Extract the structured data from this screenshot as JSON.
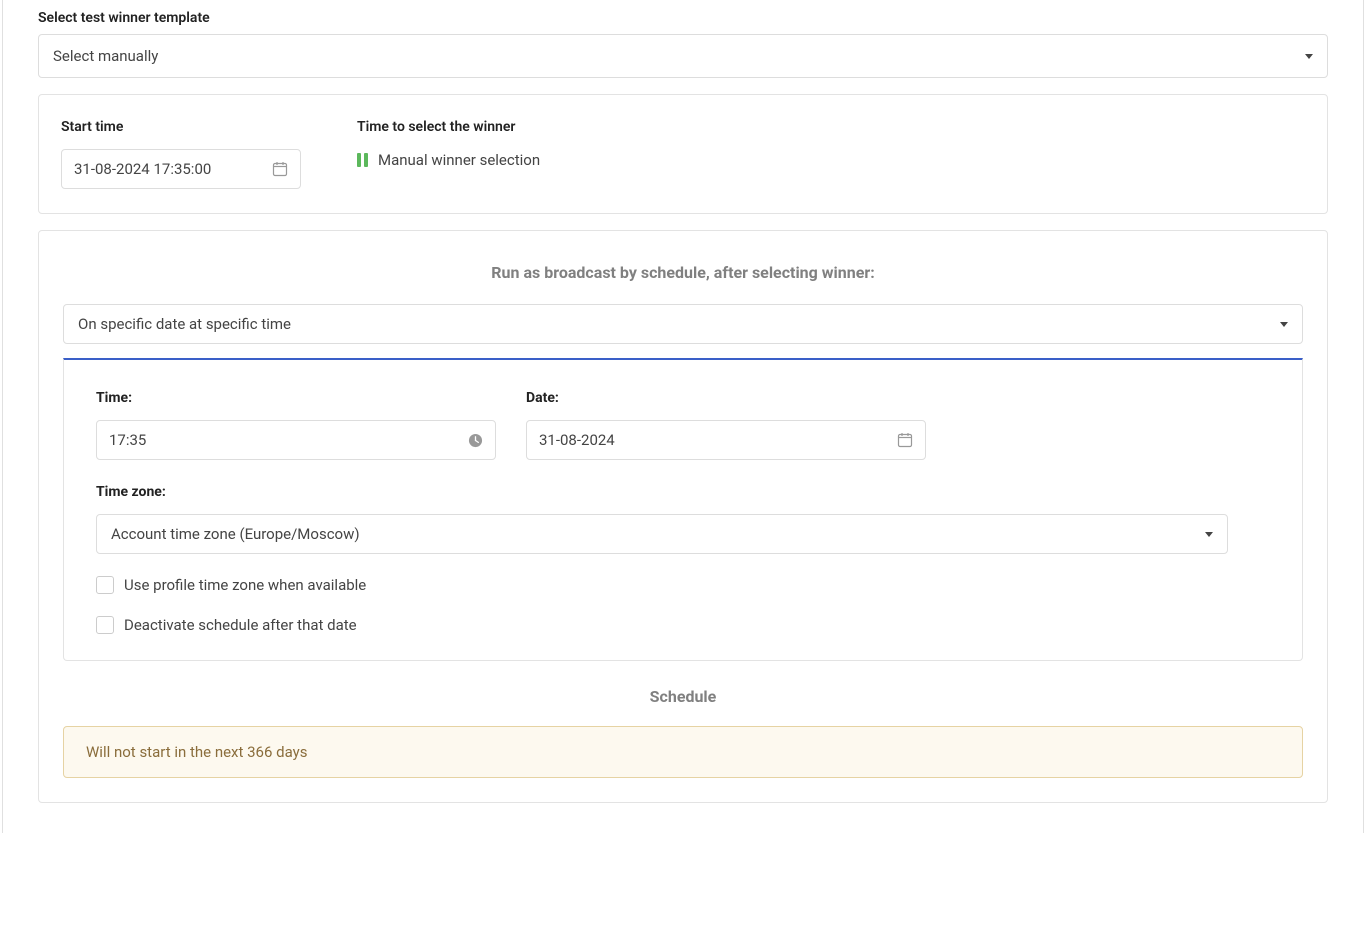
{
  "template": {
    "label": "Select test winner template",
    "value": "Select manually"
  },
  "startTime": {
    "label": "Start time",
    "value": "31-08-2024 17:35:00"
  },
  "winnerSelect": {
    "label": "Time to select the winner",
    "mode": "Manual winner selection"
  },
  "broadcast": {
    "heading": "Run as broadcast by schedule, after selecting winner:",
    "scheduleType": "On specific date at specific time"
  },
  "schedule": {
    "timeLabel": "Time:",
    "timeValue": "17:35",
    "dateLabel": "Date:",
    "dateValue": "31-08-2024",
    "tzLabel": "Time zone:",
    "tzValue": "Account time zone (Europe/Moscow)",
    "option1": "Use profile time zone when available",
    "option2": "Deactivate schedule after that date",
    "title": "Schedule",
    "warning": "Will not start in the next 366 days"
  }
}
